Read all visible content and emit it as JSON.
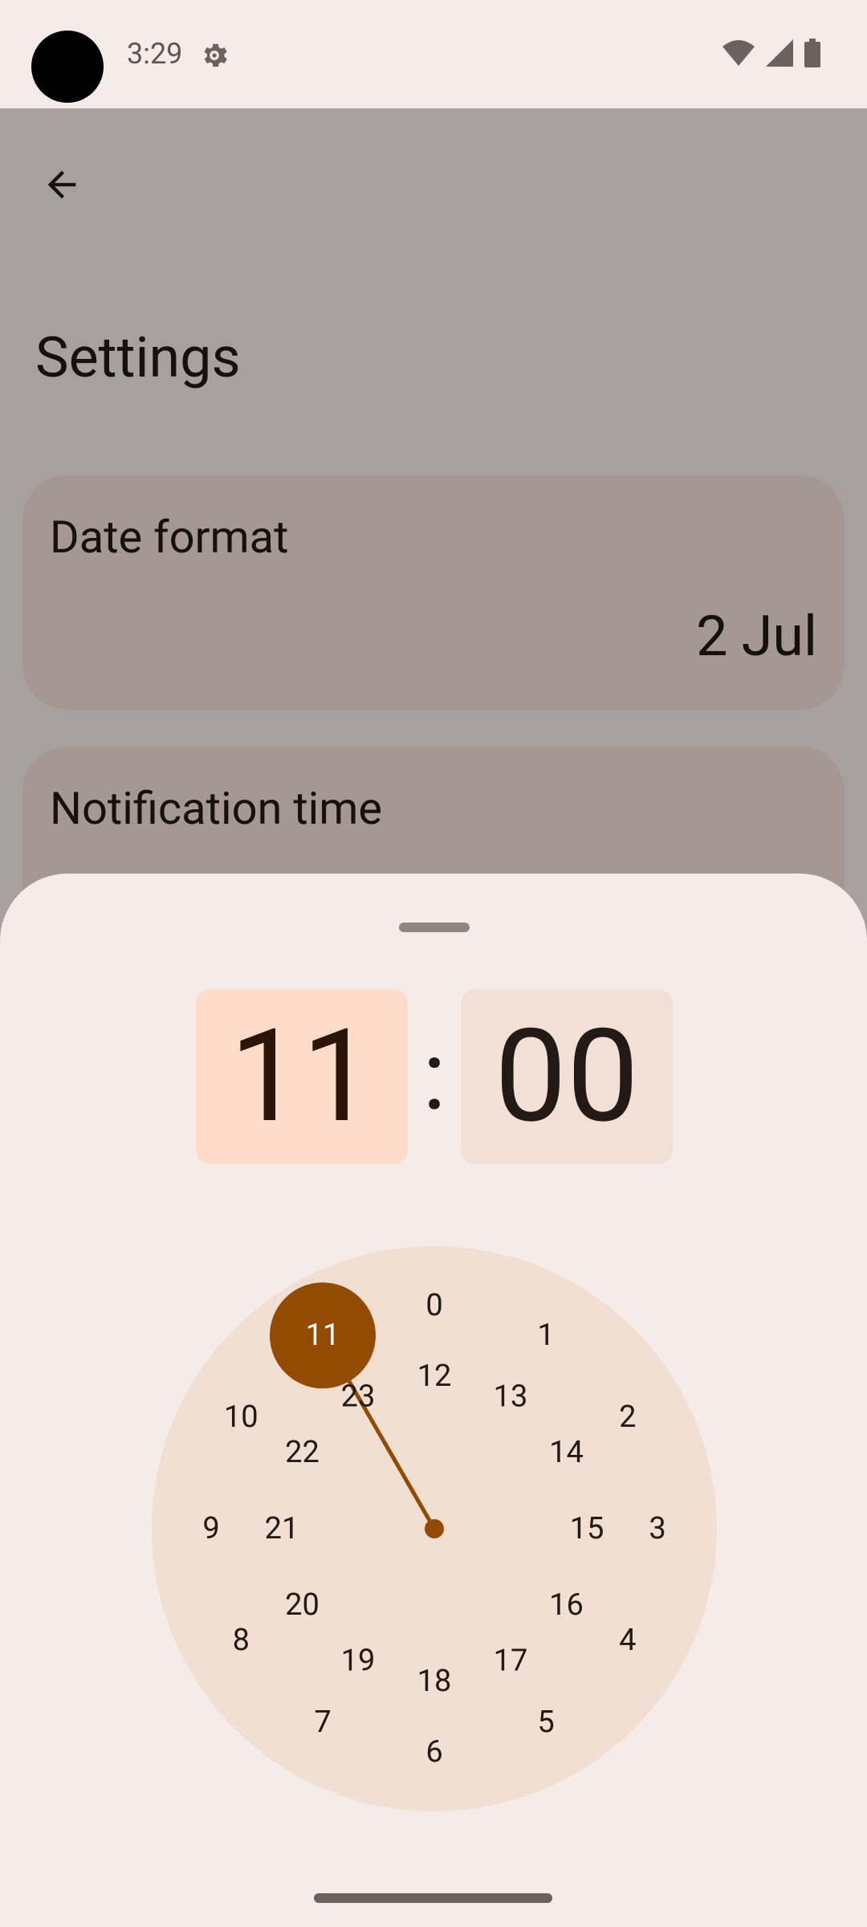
{
  "status_bar": {
    "time": "3:29",
    "icons": [
      "gear-icon",
      "wifi-icon",
      "signal-icon",
      "battery-icon"
    ]
  },
  "settings": {
    "title": "Settings",
    "back_icon": "arrow-back-icon",
    "date_format": {
      "label": "Date format",
      "value": "2 Jul"
    },
    "notification_time": {
      "label": "Notification time"
    }
  },
  "time_picker": {
    "hour": "11",
    "separator": ":",
    "minute": "00",
    "selected_hour": "11",
    "outer_hours": [
      "0",
      "1",
      "2",
      "3",
      "4",
      "5",
      "6",
      "7",
      "8",
      "9",
      "10",
      "11"
    ],
    "inner_hours": [
      "12",
      "13",
      "14",
      "15",
      "16",
      "17",
      "18",
      "19",
      "20",
      "21",
      "22",
      "23"
    ]
  },
  "colors": {
    "accent": "#934b00",
    "hour_box": "#ffdbc8",
    "minute_box": "#f2e0d6",
    "dial": "#f2dfd4",
    "sheet": "#f5ebe9"
  }
}
